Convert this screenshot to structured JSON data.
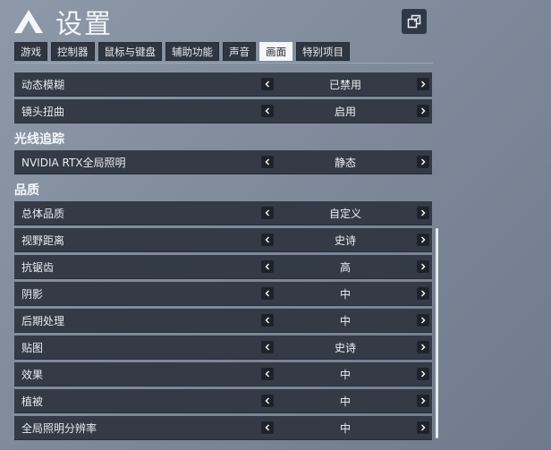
{
  "app": {
    "title": "设置"
  },
  "tabs": [
    {
      "label": "游戏",
      "active": false
    },
    {
      "label": "控制器",
      "active": false
    },
    {
      "label": "鼠标与键盘",
      "active": false
    },
    {
      "label": "辅助功能",
      "active": false
    },
    {
      "label": "声音",
      "active": false
    },
    {
      "label": "画面",
      "active": true
    },
    {
      "label": "特别项目",
      "active": false
    }
  ],
  "rows_top": [
    {
      "label": "动态模糊",
      "value": "已禁用"
    },
    {
      "label": "镜头扭曲",
      "value": "启用"
    }
  ],
  "section_raytracing": {
    "title": "光线追踪"
  },
  "rows_raytracing": [
    {
      "label": "NVIDIA RTX全局照明",
      "value": "静态"
    }
  ],
  "section_quality": {
    "title": "品质"
  },
  "rows_quality": [
    {
      "label": "总体品质",
      "value": "自定义"
    },
    {
      "label": "视野距离",
      "value": "史诗"
    },
    {
      "label": "抗锯齿",
      "value": "高"
    },
    {
      "label": "阴影",
      "value": "中"
    },
    {
      "label": "后期处理",
      "value": "中"
    },
    {
      "label": "贴图",
      "value": "史诗"
    },
    {
      "label": "效果",
      "value": "中"
    },
    {
      "label": "植被",
      "value": "中"
    },
    {
      "label": "全局照明分辨率",
      "value": "中"
    }
  ],
  "icons": {
    "prev": "chevron-left-icon",
    "next": "chevron-right-icon",
    "restore": "window-restore-icon",
    "logo": "logo-icon"
  }
}
